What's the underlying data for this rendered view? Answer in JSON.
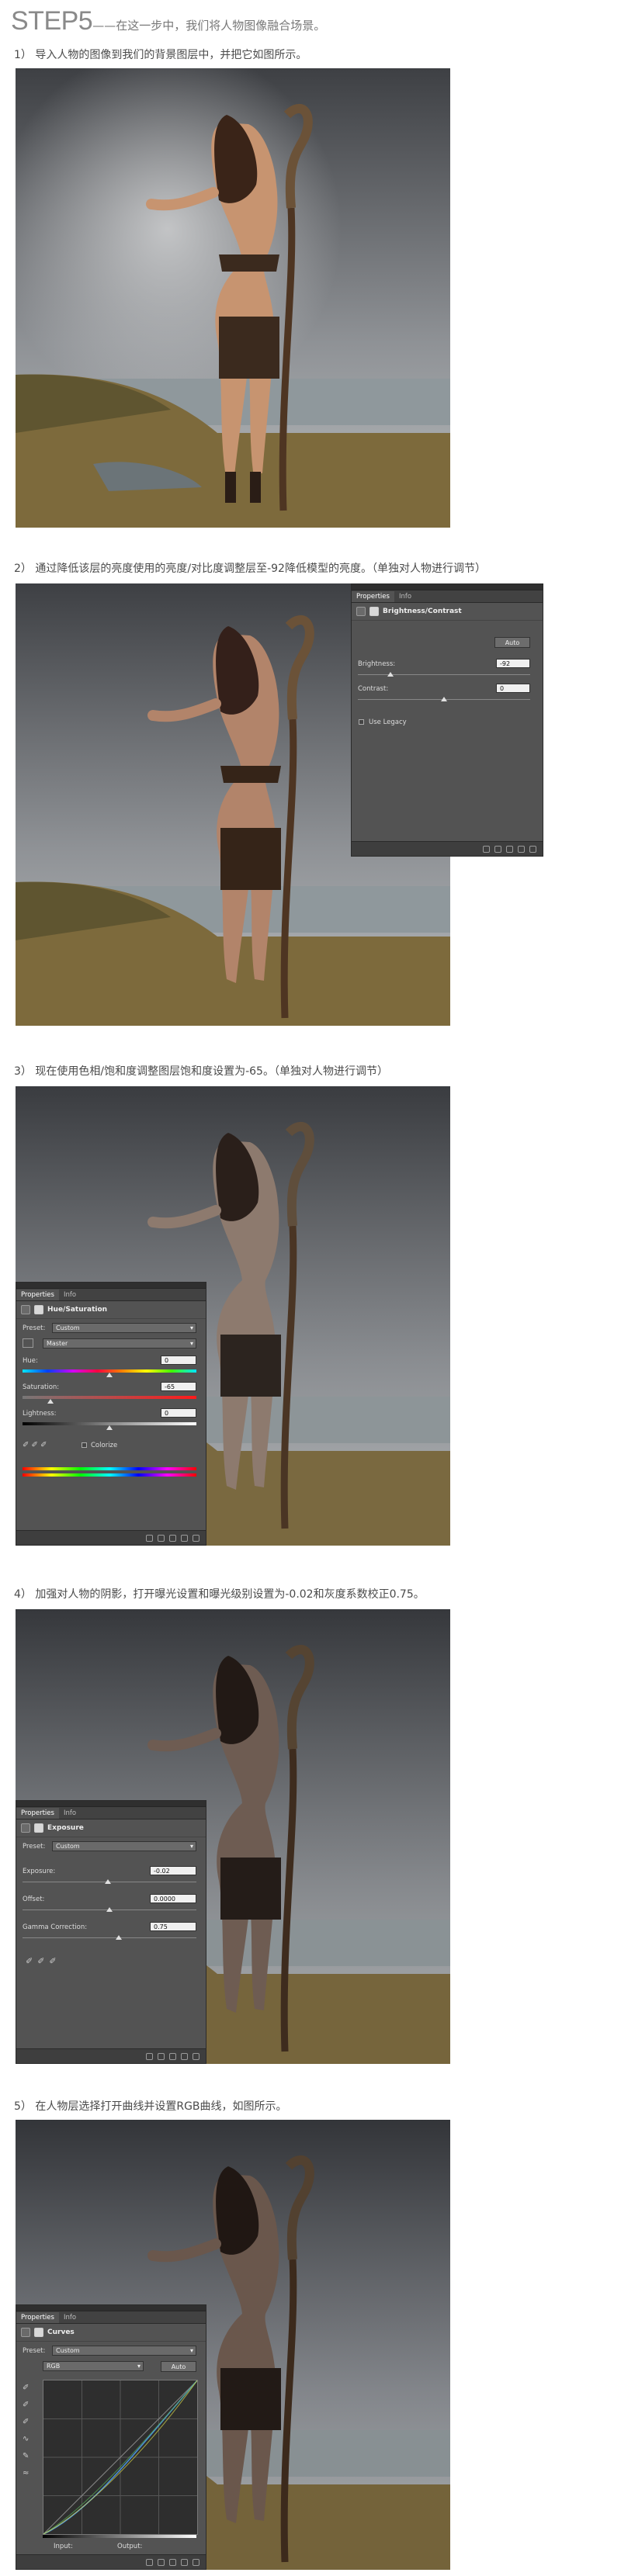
{
  "header": {
    "title": "STEP5",
    "subtitle": "——在这一步中，我们将人物图像融合场景。"
  },
  "captions": [
    "1） 导入人物的图像到我们的背景图层中，并把它如图所示。",
    "2） 通过降低该层的亮度使用的亮度/对比度调整层至-92降低模型的亮度。（单独对人物进行调节）",
    "3） 现在使用色相/饱和度调整图层饱和度设置为-65。（单独对人物进行调节）",
    "4） 加强对人物的阴影，打开曝光设置和曝光级别设置为-0.02和灰度系数校正0.75。",
    "5） 在人物层选择打开曲线并设置RGB曲线，如图所示。"
  ],
  "panels": {
    "tabs": {
      "properties": "Properties",
      "info": "Info"
    },
    "brightness": {
      "title": "Brightness/Contrast",
      "auto": "Auto",
      "brightness_label": "Brightness:",
      "brightness_value": "-92",
      "contrast_label": "Contrast:",
      "contrast_value": "0",
      "legacy_label": "Use Legacy"
    },
    "huesat": {
      "title": "Hue/Saturation",
      "preset_label": "Preset:",
      "preset_value": "Custom",
      "channel_value": "Master",
      "hue_label": "Hue:",
      "hue_value": "0",
      "sat_label": "Saturation:",
      "sat_value": "-65",
      "light_label": "Lightness:",
      "light_value": "0",
      "colorize_label": "Colorize"
    },
    "exposure": {
      "title": "Exposure",
      "preset_label": "Preset:",
      "preset_value": "Custom",
      "exposure_label": "Exposure:",
      "exposure_value": "-0.02",
      "offset_label": "Offset:",
      "offset_value": "0.0000",
      "gamma_label": "Gamma Correction:",
      "gamma_value": "0.75"
    },
    "curves": {
      "title": "Curves",
      "preset_label": "Preset:",
      "preset_value": "Custom",
      "channel_value": "RGB",
      "auto": "Auto",
      "input_label": "Input:",
      "output_label": "Output:"
    }
  },
  "colors": {
    "sky": "#6b6e72",
    "sea": "#8c9498",
    "grass": "#8a7a45",
    "skin": "#d29a72",
    "panel": "#535353"
  }
}
